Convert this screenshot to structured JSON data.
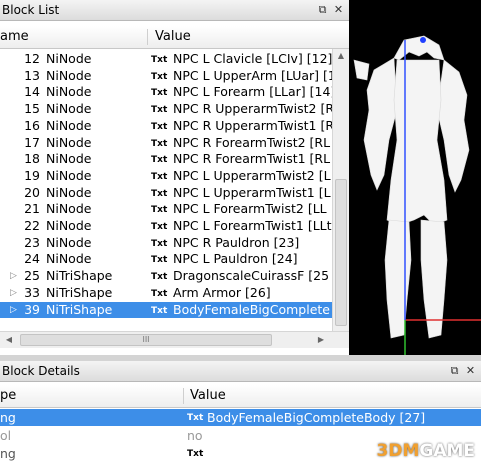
{
  "block_list": {
    "title": "Block List",
    "headers": {
      "name": "ame",
      "value": "Value"
    },
    "txt_label": "Txt",
    "rows": [
      {
        "num": "12",
        "type": "NiNode",
        "value": "NPC L Clavicle [LCIv] [12]",
        "expandable": false,
        "selected": false
      },
      {
        "num": "13",
        "type": "NiNode",
        "value": "NPC L UpperArm [LUar] [1",
        "expandable": false,
        "selected": false
      },
      {
        "num": "14",
        "type": "NiNode",
        "value": "NPC L Forearm [LLar] [14]",
        "expandable": false,
        "selected": false
      },
      {
        "num": "15",
        "type": "NiNode",
        "value": "NPC R UpperarmTwist2 [R",
        "expandable": false,
        "selected": false
      },
      {
        "num": "16",
        "type": "NiNode",
        "value": "NPC R UpperarmTwist1 [R",
        "expandable": false,
        "selected": false
      },
      {
        "num": "17",
        "type": "NiNode",
        "value": "NPC R ForearmTwist2 [RL",
        "expandable": false,
        "selected": false
      },
      {
        "num": "18",
        "type": "NiNode",
        "value": "NPC R ForearmTwist1 [RL",
        "expandable": false,
        "selected": false
      },
      {
        "num": "19",
        "type": "NiNode",
        "value": "NPC L UpperarmTwist2 [L",
        "expandable": false,
        "selected": false
      },
      {
        "num": "20",
        "type": "NiNode",
        "value": "NPC L UpperarmTwist1 [L",
        "expandable": false,
        "selected": false
      },
      {
        "num": "21",
        "type": "NiNode",
        "value": "NPC L ForearmTwist2 [LL",
        "expandable": false,
        "selected": false
      },
      {
        "num": "22",
        "type": "NiNode",
        "value": "NPC L ForearmTwist1 [LLt",
        "expandable": false,
        "selected": false
      },
      {
        "num": "23",
        "type": "NiNode",
        "value": "NPC R Pauldron [23]",
        "expandable": false,
        "selected": false
      },
      {
        "num": "24",
        "type": "NiNode",
        "value": "NPC L Pauldron [24]",
        "expandable": false,
        "selected": false
      },
      {
        "num": "25",
        "type": "NiTriShape",
        "value": "DragonscaleCuirassF [25",
        "expandable": true,
        "selected": false
      },
      {
        "num": "33",
        "type": "NiTriShape",
        "value": "Arm Armor [26]",
        "expandable": true,
        "selected": false
      },
      {
        "num": "39",
        "type": "NiTriShape",
        "value": "BodyFemaleBigComplete",
        "expandable": true,
        "selected": true
      }
    ],
    "hscroll_grip": "III"
  },
  "block_details": {
    "title": "Block Details",
    "headers": {
      "type": "pe",
      "value": "Value"
    },
    "txt_label": "Txt",
    "rows": [
      {
        "type": "ng",
        "value": "BodyFemaleBigCompleteBody [27]",
        "show_txt": true,
        "selected": true
      },
      {
        "type": "ol",
        "value": "no",
        "show_txt": false,
        "selected": false
      },
      {
        "type": "ng",
        "value": "",
        "show_txt": true,
        "selected": false
      }
    ]
  },
  "viewport": {
    "background": "#000000"
  },
  "watermark": {
    "prefix": "3DM",
    "suffix": "GAME"
  },
  "colors": {
    "selection": "#3d8ee8",
    "header_bg": "#e8e8e8"
  }
}
